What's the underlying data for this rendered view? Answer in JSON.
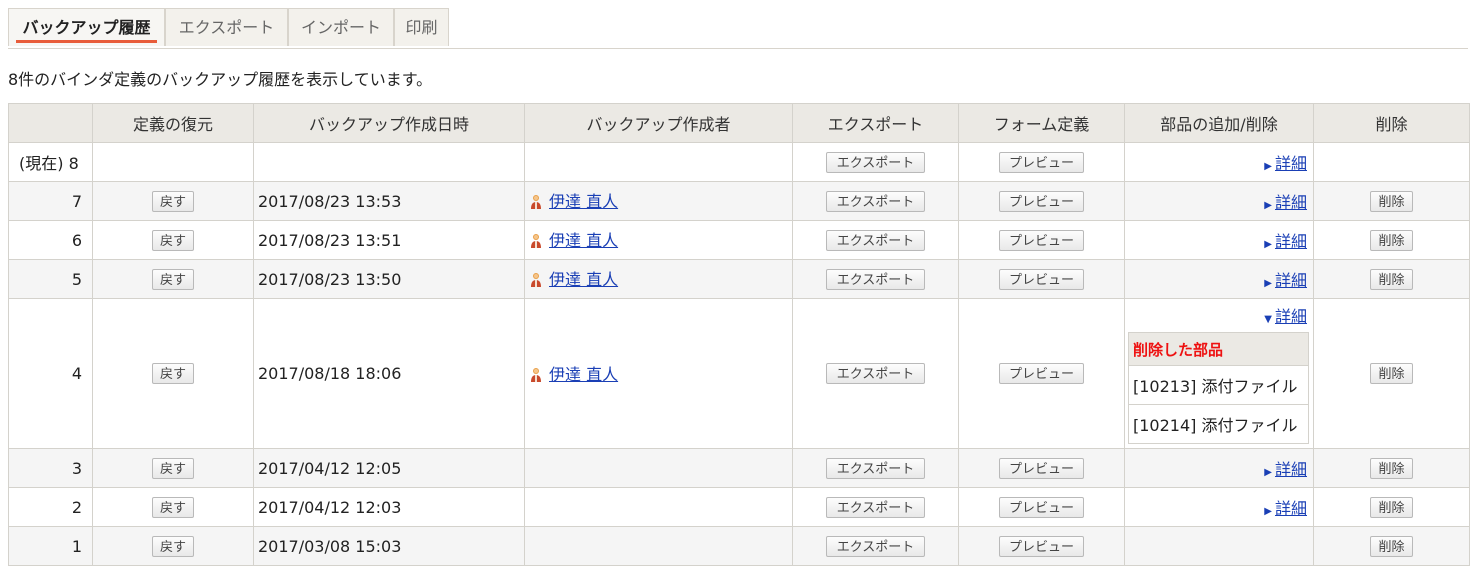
{
  "tabs": [
    {
      "label": "バックアップ履歴",
      "active": true
    },
    {
      "label": "エクスポート",
      "active": false
    },
    {
      "label": "インポート",
      "active": false
    },
    {
      "label": "印刷",
      "active": false
    }
  ],
  "summary": "8件のバインダ定義のバックアップ履歴を表示しています。",
  "columns": [
    "",
    "定義の復元",
    "バックアップ作成日時",
    "バックアップ作成者",
    "エクスポート",
    "フォーム定義",
    "部品の追加/削除",
    "削除"
  ],
  "buttons": {
    "restore": "戻す",
    "export": "エクスポート",
    "preview": "プレビュー",
    "delete": "削除",
    "detail": "詳細"
  },
  "rows": [
    {
      "num": "(現在) 8",
      "date": "",
      "author": "",
      "restore": false,
      "detail": true,
      "delete": false
    },
    {
      "num": "7",
      "date": "2017/08/23 13:53",
      "author": "伊達 直人",
      "restore": true,
      "detail": true,
      "delete": true
    },
    {
      "num": "6",
      "date": "2017/08/23 13:51",
      "author": "伊達 直人",
      "restore": true,
      "detail": true,
      "delete": true
    },
    {
      "num": "5",
      "date": "2017/08/23 13:50",
      "author": "伊達 直人",
      "restore": true,
      "detail": true,
      "delete": true
    },
    {
      "num": "4",
      "date": "2017/08/18 18:06",
      "author": "伊達 直人",
      "restore": true,
      "detail": true,
      "expanded": true,
      "delete": true
    },
    {
      "num": "3",
      "date": "2017/04/12 12:05",
      "author": "",
      "restore": true,
      "detail": true,
      "delete": true
    },
    {
      "num": "2",
      "date": "2017/04/12 12:03",
      "author": "",
      "restore": true,
      "detail": true,
      "delete": true
    },
    {
      "num": "1",
      "date": "2017/03/08 15:03",
      "author": "",
      "restore": true,
      "detail": false,
      "delete": true
    }
  ],
  "expanded_detail": {
    "header": "削除した部品",
    "items": [
      "[10213] 添付ファイル",
      "[10214] 添付ファイル"
    ]
  },
  "icons": {
    "user": "user-icon",
    "collapsed": "triangle-right-icon",
    "expanded": "triangle-down-icon"
  },
  "colors": {
    "link": "#1a3fb5",
    "tab_underline": "#e85c3a",
    "deleted_header": "#ee1111"
  }
}
